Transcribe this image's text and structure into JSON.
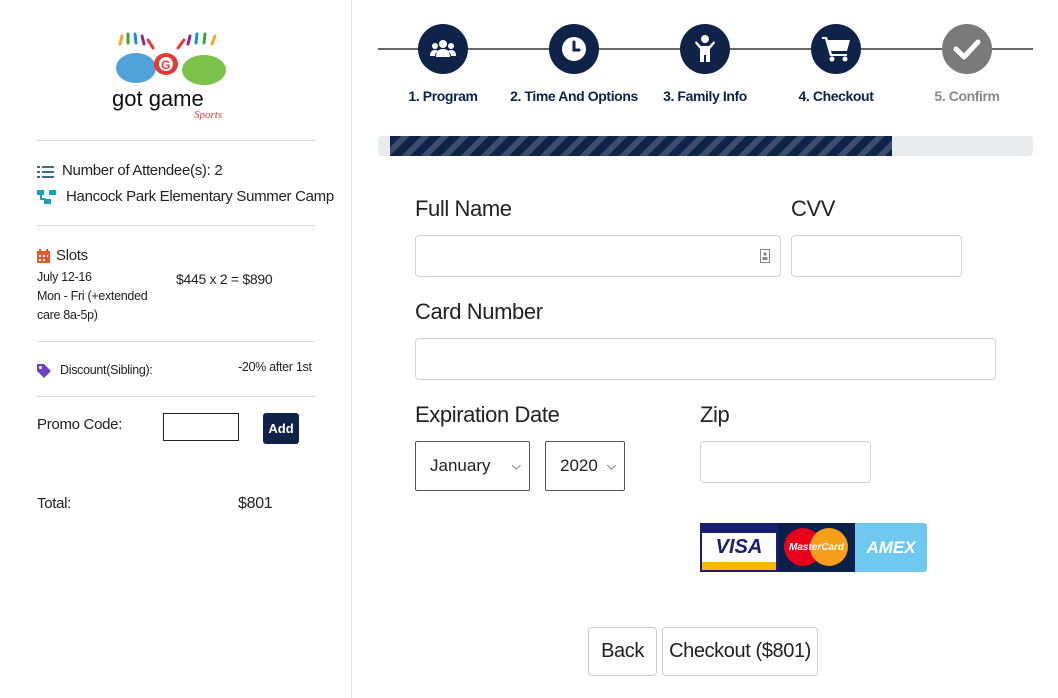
{
  "brand": {
    "logo_text": "got game",
    "logo_sub": "Sports"
  },
  "summary": {
    "attendees": "Number of Attendee(s): 2",
    "camp": "Hancock Park Elementary Summer Camp",
    "slots_heading": "Slots",
    "slot_dates": "July 12-16",
    "slot_desc_1": "Mon - Fri (+extended",
    "slot_desc_2": "care 8a-5p)",
    "slot_price": "$445 x 2 = $890",
    "discount_label": "Discount(Sibling):",
    "discount_value": "-20% after 1st",
    "promo_label": "Promo Code:",
    "promo_value": "",
    "add_label": "Add",
    "total_label": "Total:",
    "total_value": "$801"
  },
  "steps": [
    {
      "label": "1. Program",
      "icon": "group-icon"
    },
    {
      "label": "2. Time And Options",
      "icon": "clock-icon"
    },
    {
      "label": "3. Family Info",
      "icon": "person-icon"
    },
    {
      "label": "4. Checkout",
      "icon": "cart-icon"
    },
    {
      "label": "5. Confirm",
      "icon": "check-icon"
    }
  ],
  "progress": {
    "fraction": 0.8
  },
  "form": {
    "full_name_label": "Full Name",
    "full_name_value": "",
    "cvv_label": "CVV",
    "cvv_value": "",
    "card_number_label": "Card Number",
    "card_number_value": "",
    "expiration_label": "Expiration Date",
    "month_value": "January",
    "year_value": "2020",
    "zip_label": "Zip",
    "zip_value": ""
  },
  "cards": [
    "VISA",
    "MasterCard",
    "AMEX"
  ],
  "actions": {
    "back_label": "Back",
    "checkout_label": "Checkout ($801)"
  },
  "colors": {
    "navy": "#0e2347",
    "discount_tag": "#6f42c1",
    "slots_icon": "#e8592a",
    "list_icon": "#3c6e8f",
    "tree_icon": "#17a2b8"
  }
}
